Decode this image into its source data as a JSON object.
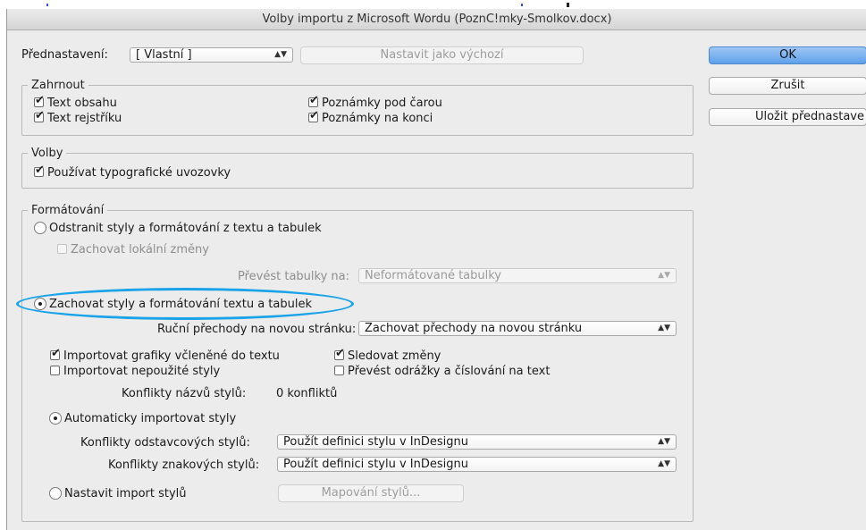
{
  "window": {
    "title": "Volby importu z Microsoft Wordu (PoznC!mky-Smolkov.docx)"
  },
  "preset": {
    "label": "Přednastavení:",
    "value": "[ Vlastní ]",
    "set_default_label": "Nastavit jako výchozí"
  },
  "buttons": {
    "ok": "OK",
    "cancel": "Zrušit",
    "save_preset": "Uložit přednastave"
  },
  "include": {
    "legend": "Zahrnout",
    "items": [
      {
        "label": "Text obsahu",
        "checked": true
      },
      {
        "label": "Text rejstříku",
        "checked": true
      },
      {
        "label": "Poznámky pod čarou",
        "checked": true
      },
      {
        "label": "Poznámky na konci",
        "checked": true
      }
    ]
  },
  "options": {
    "legend": "Volby",
    "typographic_quotes": {
      "label": "Používat typografické uvozovky",
      "checked": true
    }
  },
  "formatting": {
    "legend": "Formátování",
    "remove_styles": {
      "label": "Odstranit styly a formátování z textu a tabulek",
      "selected": false
    },
    "keep_local": {
      "label": "Zachovat lokální změny",
      "checked": false
    },
    "convert_tables_label": "Převést tabulky na:",
    "convert_tables_value": "Neformátované tabulky",
    "keep_styles": {
      "label": "Zachovat styly a formátování textu a tabulek",
      "selected": true
    },
    "page_breaks_label": "Ruční přechody na novou stránku:",
    "page_breaks_value": "Zachovat přechody na novou stránku",
    "import_graphics": {
      "label": "Importovat grafiky včleněné do textu",
      "checked": true
    },
    "track_changes": {
      "label": "Sledovat změny",
      "checked": true
    },
    "import_unused": {
      "label": "Importovat nepoužité styly",
      "checked": false
    },
    "convert_bullets": {
      "label": "Převést odrážky a číslování na text",
      "checked": false
    },
    "conflicts_label": "Konflikty názvů stylů:",
    "conflicts_value": "0 konfliktů",
    "auto_import": {
      "label": "Automaticky importovat styly",
      "selected": true
    },
    "para_conflicts_label": "Konflikty odstavcových stylů:",
    "para_conflicts_value": "Použít definici stylu v InDesignu",
    "char_conflicts_label": "Konflikty znakových stylů:",
    "char_conflicts_value": "Použít definici stylu v InDesignu",
    "custom_import": {
      "label": "Nastavit import stylů",
      "selected": false
    },
    "style_mapping_label": "Mapování stylů..."
  },
  "colors": {
    "highlight": "#1aa3e8",
    "primary_button": "#5fa0ea"
  }
}
